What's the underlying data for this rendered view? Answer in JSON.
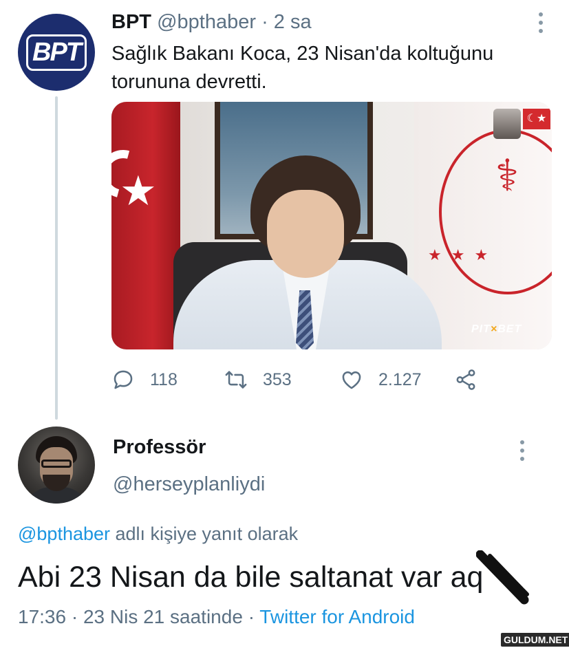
{
  "tweet": {
    "avatar_logo": "BPT",
    "name": "BPT",
    "handle": "@bpthaber",
    "separator": "·",
    "time": "2 sa",
    "text": "Sağlık Bakanı Koca, 23 Nisan'da koltuğunu torununa devretti.",
    "media": {
      "watermark_a": "PIT",
      "watermark_b": "BET"
    },
    "stats": {
      "replies": "118",
      "retweets": "353",
      "likes": "2.127"
    },
    "icons": [
      "reply-icon",
      "retweet-icon",
      "like-icon",
      "share-icon",
      "more-icon"
    ]
  },
  "reply": {
    "name": "Professör",
    "handle": "@herseyplanliydi",
    "reply_mention": "@bpthaber",
    "reply_suffix": " adlı kişiye yanıt olarak",
    "text": "Abi 23 Nisan da bile saltanat var aq",
    "time": "17:36",
    "separator": "·",
    "date": "23 Nis 21 saatinde",
    "separator2": "·",
    "source": "Twitter for Android"
  },
  "site_watermark": "GULDUM.NET",
  "colors": {
    "link": "#1b95e0",
    "secondary_text": "#5b7083",
    "bpt_avatar": "#1c2d6e"
  }
}
